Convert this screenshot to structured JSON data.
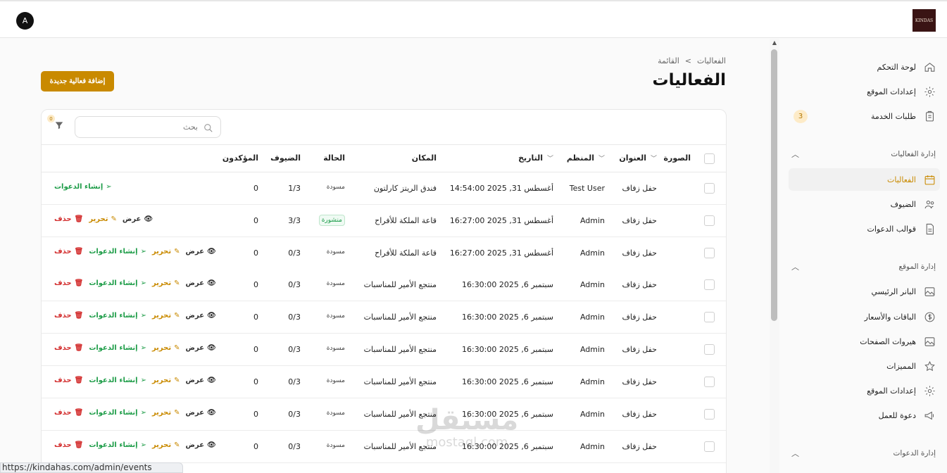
{
  "header": {
    "logo_text": "KINDAS",
    "avatar_initial": "A"
  },
  "sidebar": {
    "items_top": [
      {
        "label": "لوحة التحكم",
        "icon": "home-icon"
      },
      {
        "label": "إعدادات الموقع",
        "icon": "gear-icon"
      },
      {
        "label": "طلبات الخدمة",
        "icon": "clipboard-icon",
        "badge": "3"
      }
    ],
    "group_events": {
      "title": "إدارة الفعاليات",
      "items": [
        {
          "label": "الفعاليات",
          "icon": "calendar-icon",
          "active": true
        },
        {
          "label": "الضيوف",
          "icon": "users-icon"
        },
        {
          "label": "قوالب الدعوات",
          "icon": "document-icon"
        }
      ]
    },
    "group_site": {
      "title": "إدارة الموقع",
      "items": [
        {
          "label": "البانر الرئيسي",
          "icon": "image-icon"
        },
        {
          "label": "الباقات والأسعار",
          "icon": "dollar-icon"
        },
        {
          "label": "هيروات الصفحات",
          "icon": "image-icon"
        },
        {
          "label": "المميزات",
          "icon": "star-icon"
        },
        {
          "label": "إعدادات الموقع",
          "icon": "gear-icon"
        },
        {
          "label": "دعوة للعمل",
          "icon": "megaphone-icon"
        }
      ]
    },
    "group_invites": {
      "title": "إدارة الدعوات"
    }
  },
  "main": {
    "breadcrumb": {
      "parent": "الفعاليات",
      "current": "القائمة",
      "separator": "<"
    },
    "title": "الفعاليات",
    "add_button": "إضافة فعالية جديدة",
    "search_placeholder": "بحث",
    "filter_count": "0",
    "columns": {
      "image": "الصورة",
      "title": "العنوان",
      "organizer": "المنظم",
      "date": "التاريخ",
      "venue": "المكان",
      "status": "الحالة",
      "guests": "الضيوف",
      "confirmed": "المؤكدون"
    },
    "action_labels": {
      "view": "عرض",
      "edit": "تحرير",
      "invite": "إنشاء الدعوات",
      "delete": "حذف"
    },
    "rows": [
      {
        "title": "حفل زفاف",
        "organizer": "Test User",
        "date": "أغسطس 31, 2025 14:54:00",
        "venue": "فندق الريتز كارلتون",
        "status": "مسودة",
        "guests": "1/3",
        "confirmed": "0",
        "actions": [
          "invite"
        ]
      },
      {
        "title": "حفل زفاف",
        "organizer": "Admin",
        "date": "أغسطس 31, 2025 16:27:00",
        "venue": "قاعة الملكة للأفراح",
        "status": "منشورة",
        "published": true,
        "guests": "3/3",
        "confirmed": "0",
        "actions": [
          "view",
          "edit",
          "delete"
        ]
      },
      {
        "title": "حفل زفاف",
        "organizer": "Admin",
        "date": "أغسطس 31, 2025 16:27:00",
        "venue": "قاعة الملكة للأفراح",
        "status": "مسودة",
        "guests": "0/3",
        "confirmed": "0",
        "actions": [
          "view",
          "edit",
          "invite",
          "delete"
        ]
      },
      {
        "title": "حفل زفاف",
        "organizer": "Admin",
        "date": "سبتمبر 6, 2025 16:30:00",
        "venue": "منتجع الأمير للمناسبات",
        "status": "مسودة",
        "guests": "0/3",
        "confirmed": "0",
        "actions": [
          "view",
          "edit",
          "invite",
          "delete"
        ]
      },
      {
        "title": "حفل زفاف",
        "organizer": "Admin",
        "date": "سبتمبر 6, 2025 16:30:00",
        "venue": "منتجع الأمير للمناسبات",
        "status": "مسودة",
        "guests": "0/3",
        "confirmed": "0",
        "actions": [
          "view",
          "edit",
          "invite",
          "delete"
        ]
      },
      {
        "title": "حفل زفاف",
        "organizer": "Admin",
        "date": "سبتمبر 6, 2025 16:30:00",
        "venue": "منتجع الأمير للمناسبات",
        "status": "مسودة",
        "guests": "0/3",
        "confirmed": "0",
        "actions": [
          "view",
          "edit",
          "invite",
          "delete"
        ]
      },
      {
        "title": "حفل زفاف",
        "organizer": "Admin",
        "date": "سبتمبر 6, 2025 16:30:00",
        "venue": "منتجع الأمير للمناسبات",
        "status": "مسودة",
        "guests": "0/3",
        "confirmed": "0",
        "actions": [
          "view",
          "edit",
          "invite",
          "delete"
        ]
      },
      {
        "title": "حفل زفاف",
        "organizer": "Admin",
        "date": "سبتمبر 6, 2025 16:30:00",
        "venue": "منتجع الأمير للمناسبات",
        "status": "مسودة",
        "guests": "0/3",
        "confirmed": "0",
        "actions": [
          "view",
          "edit",
          "invite",
          "delete"
        ]
      },
      {
        "title": "حفل زفاف",
        "organizer": "Admin",
        "date": "سبتمبر 6, 2025 16:30:00",
        "venue": "منتجع الأمير للمناسبات",
        "status": "مسودة",
        "guests": "0/3",
        "confirmed": "0",
        "actions": [
          "view",
          "edit",
          "invite",
          "delete"
        ]
      }
    ]
  },
  "statusbar": {
    "url": "https://kindahas.com/admin/events"
  },
  "watermark": {
    "arabic": "مستقل",
    "latin": "mostaql.com"
  },
  "colors": {
    "accent": "#c98a00",
    "danger": "#d32f2f",
    "success": "#1f9d49"
  }
}
